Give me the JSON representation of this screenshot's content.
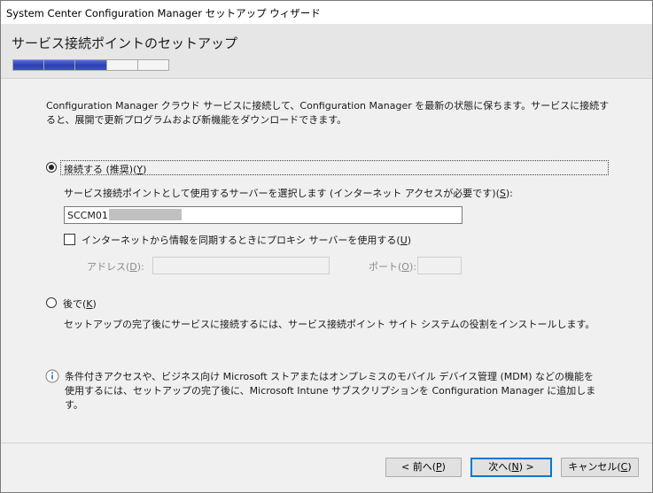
{
  "window": {
    "title": "System Center Configuration Manager セットアップ ウィザード"
  },
  "header": {
    "title": "サービス接続ポイントのセットアップ",
    "progress": {
      "total_steps": 5,
      "completed_steps": 3
    }
  },
  "intro": "Configuration Manager クラウド サービスに接続して、Configuration Manager を最新の状態に保ちます。サービスに接続すると、展開で更新プログラムおよび新機能をダウンロードできます。",
  "connect": {
    "label": "接続する (推奨)",
    "mnemonic": "Y",
    "selected": true
  },
  "server": {
    "label": "サービス接続ポイントとして使用するサーバーを選択します (インターネット アクセスが必要です)",
    "mnemonic": "S",
    "value": "SCCM01"
  },
  "proxy": {
    "label": "インターネットから情報を同期するときにプロキシ サーバーを使用する",
    "mnemonic": "U",
    "checked": false,
    "address_label": "アドレス",
    "address_mnemonic": "D",
    "address_value": "",
    "port_label": "ポート",
    "port_mnemonic": "O",
    "port_value": ""
  },
  "later": {
    "label": "後で",
    "mnemonic": "K",
    "selected": false,
    "description": "セットアップの完了後にサービスに接続するには、サービス接続ポイント サイト システムの役割をインストールします。"
  },
  "info": {
    "icon": "info-icon",
    "text": "条件付きアクセスや、ビジネス向け Microsoft ストアまたはオンプレミスのモバイル デバイス管理 (MDM) などの機能を使用するには、セットアップの完了後に、Microsoft Intune サブスクリプションを Configuration Manager に追加します。"
  },
  "buttons": {
    "back": {
      "prefix": "< 前へ(",
      "mnemonic": "P",
      "suffix": ")"
    },
    "next": {
      "prefix": "次へ(",
      "mnemonic": "N",
      "suffix": ") >"
    },
    "cancel": {
      "prefix": "キャンセル(",
      "mnemonic": "C",
      "suffix": ")"
    }
  },
  "colors": {
    "progress_fill": "#2b3fb5",
    "default_button_border": "#0078d7"
  }
}
